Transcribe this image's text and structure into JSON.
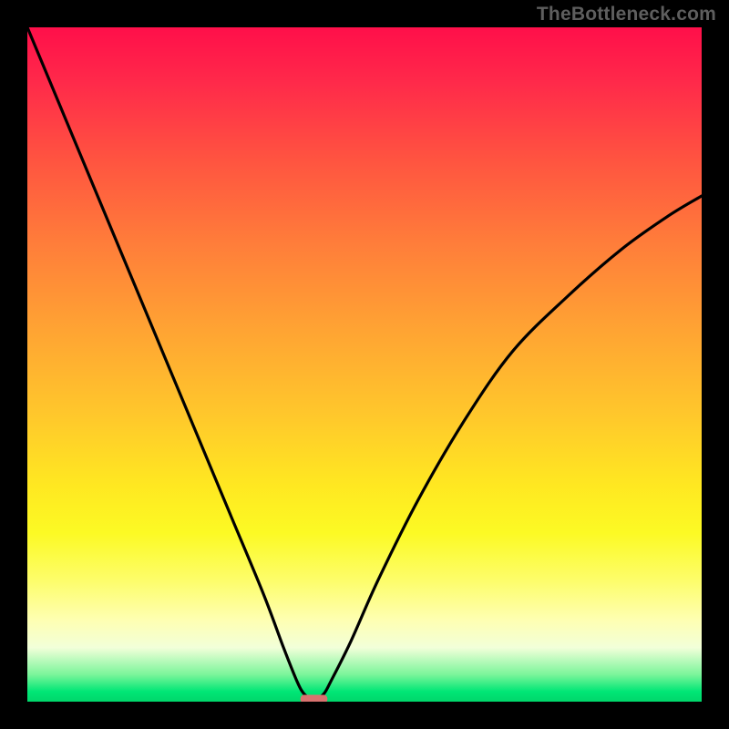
{
  "watermark": "TheBottleneck.com",
  "chart_data": {
    "type": "line",
    "title": "",
    "xlabel": "",
    "ylabel": "",
    "xlim": [
      0,
      100
    ],
    "ylim": [
      0,
      100
    ],
    "series": [
      {
        "name": "bottleneck-curve",
        "x": [
          0,
          5,
          10,
          15,
          20,
          25,
          30,
          35,
          38,
          40,
          41,
          42,
          43,
          44,
          45,
          48,
          52,
          58,
          65,
          72,
          80,
          88,
          95,
          100
        ],
        "y": [
          100,
          88,
          76,
          64,
          52,
          40,
          28,
          16,
          8,
          3,
          1.2,
          0.5,
          0.5,
          1.2,
          3,
          9,
          18,
          30,
          42,
          52,
          60,
          67,
          72,
          75
        ]
      }
    ],
    "marker": {
      "name": "optimal-zone",
      "x_range": [
        40.5,
        44.5
      ],
      "y": 0.4,
      "color": "#d8726f"
    },
    "background": {
      "type": "vertical-gradient",
      "stops": [
        {
          "pos": 0.0,
          "color": "#ff0f4a"
        },
        {
          "pos": 0.2,
          "color": "#ff5540"
        },
        {
          "pos": 0.45,
          "color": "#ffa433"
        },
        {
          "pos": 0.68,
          "color": "#ffe821"
        },
        {
          "pos": 0.88,
          "color": "#feffb3"
        },
        {
          "pos": 0.97,
          "color": "#4eec88"
        },
        {
          "pos": 1.0,
          "color": "#00d66a"
        }
      ]
    }
  }
}
